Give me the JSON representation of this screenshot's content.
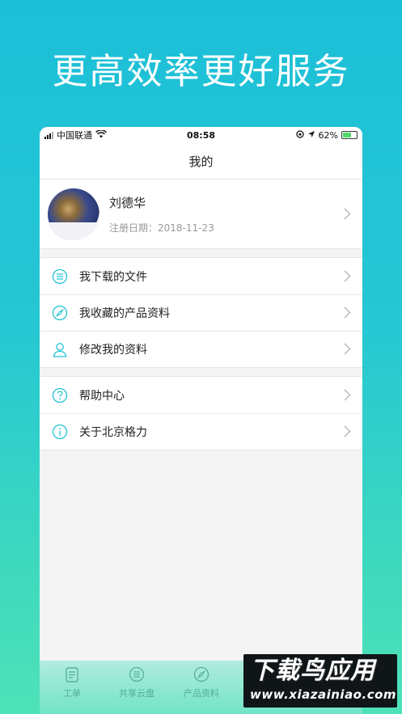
{
  "promo": {
    "headline": "更高效率更好服务"
  },
  "status_bar": {
    "carrier": "中国联通",
    "time": "08:58",
    "battery": "62%",
    "battery_level": 0.62
  },
  "nav": {
    "title": "我的"
  },
  "profile": {
    "name": "刘德华",
    "reg_date": "注册日期：2018-11-23"
  },
  "menu_group_1": [
    {
      "label": "我下载的文件",
      "icon": "download-list-icon"
    },
    {
      "label": "我收藏的产品资料",
      "icon": "compass-icon"
    },
    {
      "label": "修改我的资料",
      "icon": "user-icon"
    }
  ],
  "menu_group_2": [
    {
      "label": "帮助中心",
      "icon": "help-icon"
    },
    {
      "label": "关于北京格力",
      "icon": "info-icon"
    }
  ],
  "tabbar": [
    {
      "label": "工单",
      "icon": "clipboard-icon"
    },
    {
      "label": "共享云盘",
      "icon": "cloud-disk-icon"
    },
    {
      "label": "产品资料",
      "icon": "compass-icon"
    }
  ],
  "watermark": {
    "main": "下载鸟应用",
    "url": "www.xiazainiao.com"
  },
  "colors": {
    "accent": "#2ec7d3",
    "icon": "#25c4d3",
    "chevron": "#b5b5b5"
  }
}
